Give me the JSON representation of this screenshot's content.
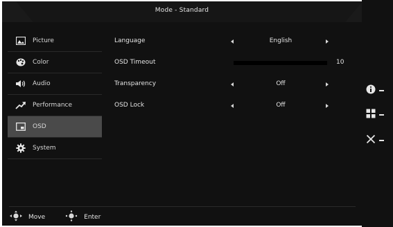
{
  "header": {
    "title": "Mode - Standard"
  },
  "sidebar": {
    "items": [
      {
        "label": "Picture",
        "icon": "picture-icon",
        "active": false
      },
      {
        "label": "Color",
        "icon": "palette-icon",
        "active": false
      },
      {
        "label": "Audio",
        "icon": "speaker-icon",
        "active": false
      },
      {
        "label": "Performance",
        "icon": "trend-icon",
        "active": false
      },
      {
        "label": "OSD",
        "icon": "osd-icon",
        "active": true
      },
      {
        "label": "System",
        "icon": "gear-icon",
        "active": false
      }
    ]
  },
  "settings": {
    "language": {
      "label": "Language",
      "value": "English"
    },
    "osd_timeout": {
      "label": "OSD Timeout",
      "value": "10"
    },
    "transparency": {
      "label": "Transparency",
      "value": "Off"
    },
    "osd_lock": {
      "label": "OSD Lock",
      "value": "Off"
    }
  },
  "footer": {
    "move_label": "Move",
    "enter_label": "Enter"
  },
  "right_buttons": [
    {
      "icon": "info-icon"
    },
    {
      "icon": "grid-icon"
    },
    {
      "icon": "close-icon"
    }
  ]
}
